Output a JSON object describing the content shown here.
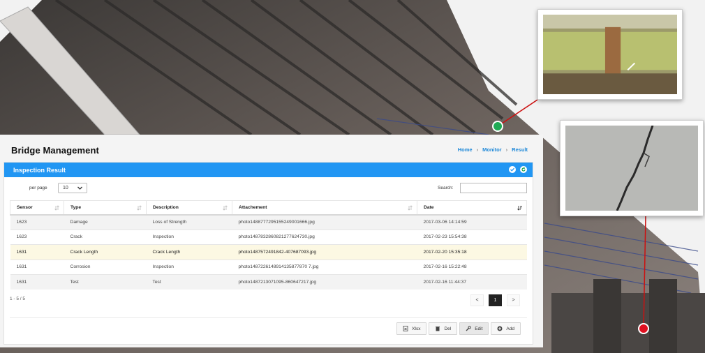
{
  "page": {
    "title": "Bridge Management",
    "breadcrumb": [
      "Home",
      "Monitor",
      "Result"
    ]
  },
  "box": {
    "title": "Inspection Result",
    "tools": [
      "check-icon",
      "refresh-icon"
    ]
  },
  "controls": {
    "per_page_label": "per page",
    "per_page_value": "10",
    "search_label": "Search:",
    "search_value": ""
  },
  "table": {
    "columns": [
      "Sensor",
      "Type",
      "Description",
      "Attachement",
      "Date"
    ],
    "rows": [
      [
        "1623",
        "Damage",
        "Loss of Strength",
        "photo1488777295155249001666.jpg",
        "2017-03-06 14:14:59"
      ],
      [
        "1623",
        "Crack",
        "Inspection",
        "photo1487832860821277624730.jpg",
        "2017-02-23 15:54:38"
      ],
      [
        "1631",
        "Crack Length",
        "Crack Length",
        "photo1487572491842-407687093.jpg",
        "2017-02-20 15:35:18"
      ],
      [
        "1631",
        "Corrosion",
        "Inspection",
        "photo1487226148914135877870 7.jpg",
        "2017-02-16 15:22:48"
      ],
      [
        "1631",
        "Test",
        "Test",
        "photo1487213071095-860647217.jpg",
        "2017-02-16 11:44:37"
      ]
    ],
    "highlight_row": 2
  },
  "pagination": {
    "info": "1 - 5 / 5",
    "prev": "<",
    "current": "1",
    "next": ">"
  },
  "actions": {
    "xlsx": "Xlsx",
    "del": "Del",
    "edit": "Edit",
    "add": "Add"
  },
  "colors": {
    "accent": "#2196f3",
    "marker_ok": "#1faa55",
    "marker_alert": "#e01020"
  }
}
